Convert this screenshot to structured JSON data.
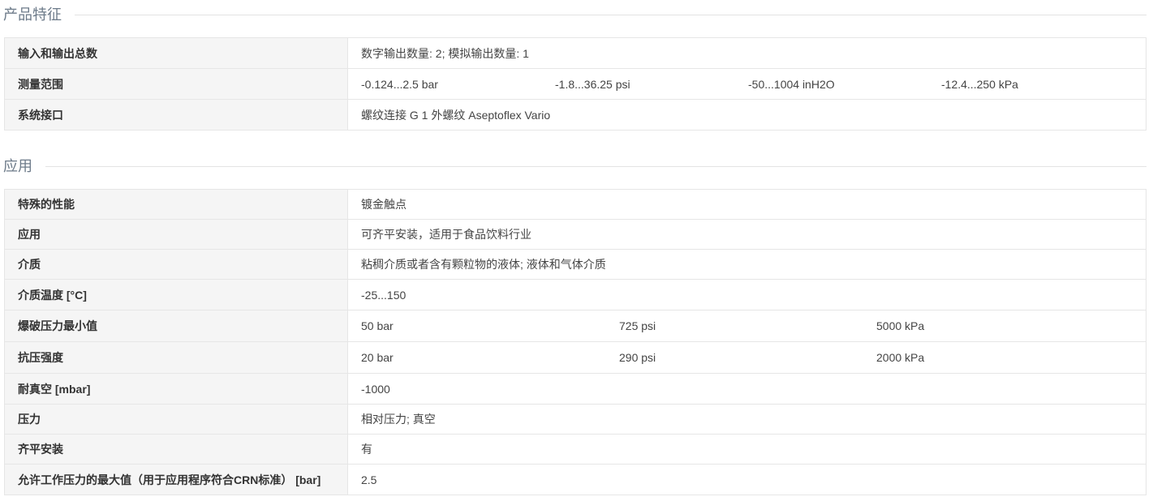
{
  "sections": [
    {
      "title": "产品特征",
      "rows": [
        {
          "label": "输入和输出总数",
          "values": [
            "数字输出数量: 2; 模拟输出数量: 1"
          ]
        },
        {
          "label": "测量范围",
          "values": [
            "-0.124...2.5 bar",
            "-1.8...36.25 psi",
            "-50...1004 inH2O",
            "-12.4...250 kPa"
          ]
        },
        {
          "label": "系统接口",
          "values": [
            "螺纹连接 G 1 外螺纹 Aseptoflex Vario"
          ]
        }
      ]
    },
    {
      "title": "应用",
      "rows": [
        {
          "label": "特殊的性能",
          "values": [
            "镀金触点"
          ]
        },
        {
          "label": "应用",
          "values": [
            "可齐平安装，适用于食品饮料行业"
          ]
        },
        {
          "label": "介质",
          "values": [
            "粘稠介质或者含有颗粒物的液体; 液体和气体介质"
          ]
        },
        {
          "label": "介质温度 [°C]",
          "values": [
            "-25...150"
          ]
        },
        {
          "label": "爆破压力最小值",
          "values": [
            "50 bar",
            "725 psi",
            "5000 kPa"
          ]
        },
        {
          "label": "抗压强度",
          "values": [
            "20 bar",
            "290 psi",
            "2000 kPa"
          ]
        },
        {
          "label": "耐真空 [mbar]",
          "values": [
            "-1000"
          ]
        },
        {
          "label": "压力",
          "values": [
            "相对压力; 真空"
          ]
        },
        {
          "label": "齐平安装",
          "values": [
            "有"
          ]
        },
        {
          "label": "允许工作压力的最大值（用于应用程序符合CRN标准） [bar]",
          "values": [
            "2.5"
          ]
        }
      ]
    }
  ]
}
